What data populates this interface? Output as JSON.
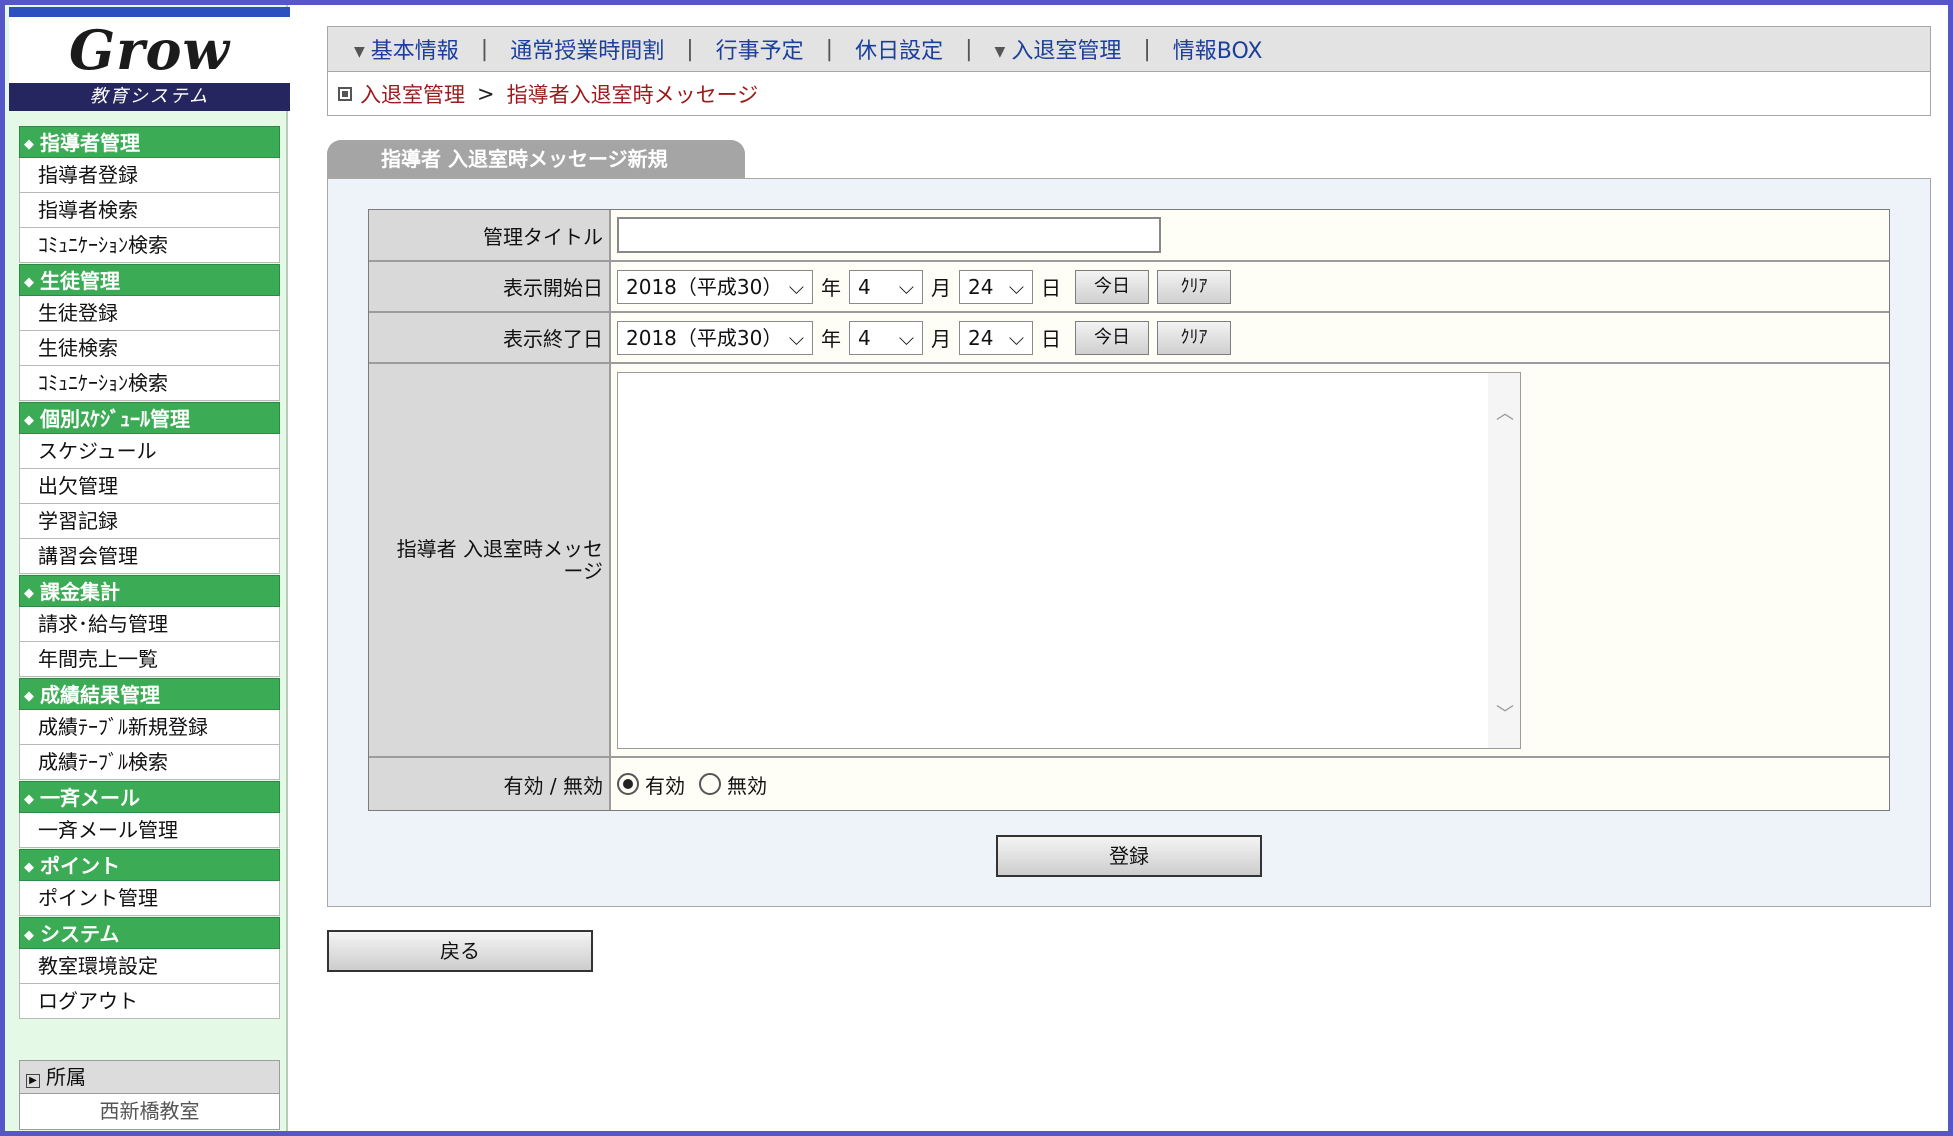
{
  "logo": {
    "brand": "Grow",
    "subtitle": "教育システム"
  },
  "sidebar": {
    "sections": [
      {
        "heading": "指導者管理",
        "items": [
          "指導者登録",
          "指導者検索",
          "ｺﾐｭﾆｹｰｼｮﾝ検索"
        ]
      },
      {
        "heading": "生徒管理",
        "items": [
          "生徒登録",
          "生徒検索",
          "ｺﾐｭﾆｹｰｼｮﾝ検索"
        ]
      },
      {
        "heading": "個別ｽｹｼﾞｭｰﾙ管理",
        "items": [
          "スケジュール",
          "出欠管理",
          "学習記録",
          "講習会管理"
        ]
      },
      {
        "heading": "課金集計",
        "items": [
          "請求･給与管理",
          "年間売上一覧"
        ]
      },
      {
        "heading": "成績結果管理",
        "items": [
          "成績ﾃｰﾌﾞﾙ新規登録",
          "成績ﾃｰﾌﾞﾙ検索"
        ]
      },
      {
        "heading": "一斉メール",
        "items": [
          "一斉メール管理"
        ]
      },
      {
        "heading": "ポイント",
        "items": [
          "ポイント管理"
        ]
      },
      {
        "heading": "システム",
        "items": [
          "教室環境設定",
          "ログアウト"
        ]
      }
    ],
    "affiliation": {
      "heading": "所属",
      "value": "西新橋教室"
    }
  },
  "topnav": {
    "items": [
      "基本情報",
      "通常授業時間割",
      "行事予定",
      "休日設定",
      "入退室管理",
      "情報BOX"
    ],
    "sep": "|"
  },
  "breadcrumb": {
    "parent": "入退室管理",
    "sep": ">",
    "current": "指導者入退室時メッセージ"
  },
  "tab": {
    "label": "指導者 入退室時メッセージ新規"
  },
  "form": {
    "title_label": "管理タイトル",
    "title_value": "",
    "start_label": "表示開始日",
    "end_label": "表示終了日",
    "start": {
      "year": "2018（平成30）",
      "month": "4",
      "day": "24"
    },
    "end": {
      "year": "2018（平成30）",
      "month": "4",
      "day": "24"
    },
    "year_unit": "年",
    "month_unit": "月",
    "day_unit": "日",
    "today_button": "今日",
    "clear_button": "ｸﾘｱ",
    "message_label": "指導者 入退室時メッセージ",
    "message_value": "",
    "status_label": "有効 / 無効",
    "status_options": [
      "有効",
      "無効"
    ],
    "status_selected": "有効"
  },
  "buttons": {
    "submit": "登録",
    "back": "戻る"
  },
  "colors": {
    "menu_heading_bg": "#3cab55",
    "sidebar_bg": "#e4fae6",
    "frame": "#5656c8",
    "breadcrumb_text": "#9b1b1b",
    "nav_text": "#1c3f9b"
  }
}
